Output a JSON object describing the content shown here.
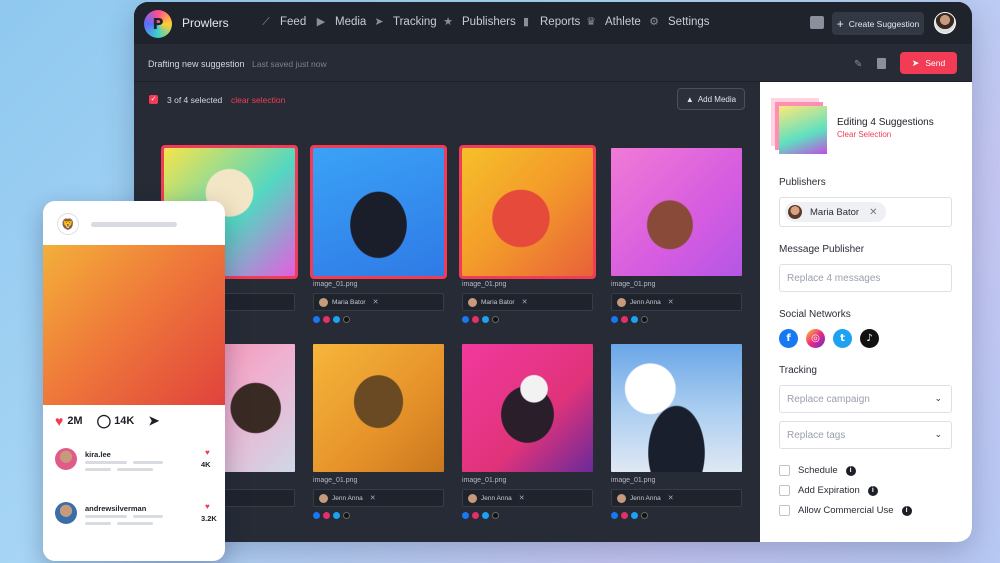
{
  "app": {
    "logo_letter": "P",
    "brand": "Prowlers",
    "nav": [
      {
        "label": "Feed",
        "icon": "feed-trend-icon"
      },
      {
        "label": "Media",
        "icon": "media-play-icon"
      },
      {
        "label": "Tracking",
        "icon": "tracking-send-icon"
      },
      {
        "label": "Publishers",
        "icon": "publishers-star-icon"
      },
      {
        "label": "Reports",
        "icon": "reports-bar-icon"
      },
      {
        "label": "Athlete",
        "icon": "athlete-trophy-icon"
      },
      {
        "label": "Settings",
        "icon": "settings-gear-icon"
      }
    ],
    "create_label": "Create Suggestion",
    "accent": "#f23b55"
  },
  "draft": {
    "title": "Drafting new suggestion",
    "saved": "Last saved just now",
    "send_label": "Send"
  },
  "selection": {
    "count_label": "3 of 4 selected",
    "clear_label": "clear selection",
    "add_media_label": "Add Media"
  },
  "cards": [
    {
      "filename": "",
      "publisher": "",
      "selected": true
    },
    {
      "filename": "image_01.png",
      "publisher": "Maria Bator",
      "selected": true
    },
    {
      "filename": "image_01.png",
      "publisher": "Maria Bator",
      "selected": true
    },
    {
      "filename": "image_01.png",
      "publisher": "Jenn Anna",
      "selected": false
    },
    {
      "filename": "",
      "publisher": "",
      "selected": false
    },
    {
      "filename": "image_01.png",
      "publisher": "Jenn Anna",
      "selected": false
    },
    {
      "filename": "image_01.png",
      "publisher": "Jenn Anna",
      "selected": false
    },
    {
      "filename": "image_01.png",
      "publisher": "Jenn Anna",
      "selected": false
    }
  ],
  "panel": {
    "title": "Editing 4 Suggestions",
    "clear_label": "Clear Selection",
    "publishers_label": "Publishers",
    "publisher_chip": "Maria Bator",
    "message_label": "Message Publisher",
    "message_placeholder": "Replace 4 messages",
    "social_label": "Social Networks",
    "social_icons": [
      "facebook-icon",
      "instagram-icon",
      "twitter-icon",
      "tiktok-icon"
    ],
    "tracking_label": "Tracking",
    "campaign_placeholder": "Replace campaign",
    "tags_placeholder": "Replace tags",
    "options": [
      {
        "label": "Schedule"
      },
      {
        "label": "Add Expiration"
      },
      {
        "label": "Allow Commercial Use"
      }
    ]
  },
  "phone": {
    "likes": "2M",
    "comments_count": "14K",
    "comments": [
      {
        "user": "kira.lee",
        "likes": "4K"
      },
      {
        "user": "andrewsilverman",
        "likes": "3.2K"
      }
    ]
  }
}
